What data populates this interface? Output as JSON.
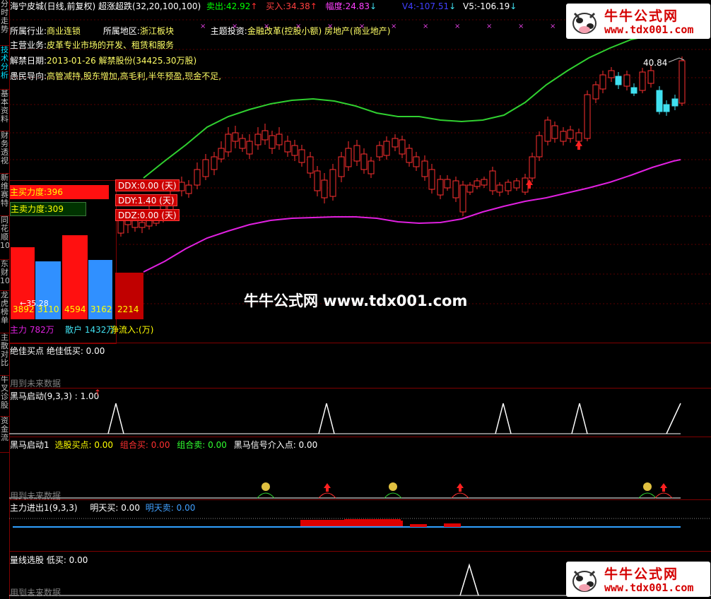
{
  "header": {
    "stock": "海宁皮城(日线,前复权)",
    "indicator": "超涨超跌(32,20,100,100)",
    "sell_label": "卖出:",
    "sell_value": "42.92",
    "buy_label": "买入:",
    "buy_value": "34.38",
    "amp_label": "幅度:",
    "amp_value": "24.83",
    "v4_label": "V4:",
    "v4_value": "-107.51",
    "v5_label": "V5:",
    "v5_value": "-106.19"
  },
  "info": {
    "industry_label": "所属行业:",
    "industry": "商业连锁",
    "region_label": "所属地区:",
    "region": "浙江板块",
    "theme_label": "主题投资:",
    "theme": "金融改革(控股小额) 房地产(商业地产)",
    "business_label": "主营业务:",
    "business": "皮革专业市场的开发、租赁和服务",
    "unlock_label": "解禁日期:",
    "unlock": "2013-01-26 解禁股份(34425.30万股)",
    "guide_label": "愚民导向:",
    "guide": "高管减持,股东增加,高毛利,半年预盈,现金不足,"
  },
  "side_tabs": [
    "分时走势",
    "技术分析",
    "基本资料",
    "财务透视",
    "新维赛特",
    "同花顺10",
    "东财10",
    "龙虎榜单",
    "主散对比",
    "牛叉诊股",
    "资金流"
  ],
  "force": {
    "buy_label": "主买力度:396",
    "sell_label": "主卖力度:309",
    "bars": [
      "3892",
      "3110",
      "4594",
      "3162",
      "2214"
    ],
    "low_mark": "35.28",
    "main_label": "主力 782万",
    "retail_label": "散户 1432万",
    "net_label": "净流入:(万)",
    "ddx": "DDX:0.00 (天)",
    "ddy": "DDY:1.40 (天)",
    "ddz": "DDZ:0.00 (天)"
  },
  "price_high": "40.84",
  "watermark_center": "牛牛公式网 www.tdx001.com",
  "watermark": {
    "brand": "牛牛公式网",
    "url": "www.tdx001.com"
  },
  "panels": {
    "p1_title": "绝佳买点 绝佳低买: 0.00",
    "p1_future": "用到未来数据",
    "p2_title": "黑马启动(9,3,3) : 1.00",
    "p3_a": "黑马启动1",
    "p3_b": "选股买点: 0.00",
    "p3_c": "组合买: 0.00",
    "p3_d": "组合卖: 0.00",
    "p3_e": "黑马信号介入点: 0.00",
    "p3_future": "用到未来数据",
    "p4_a": "主力进出1(9,3,3)",
    "p4_b": "明天买: 0.00",
    "p4_c": "明天卖: 0.00",
    "p5_title": "量线选股 低买: 0.00",
    "p5_future": "用到未来数据"
  },
  "colors": {
    "up": "#ff3030",
    "down": "#40e0f0",
    "upper_band": "#30d030",
    "lower_band": "#e020e0",
    "panel_border": "#800000"
  }
}
